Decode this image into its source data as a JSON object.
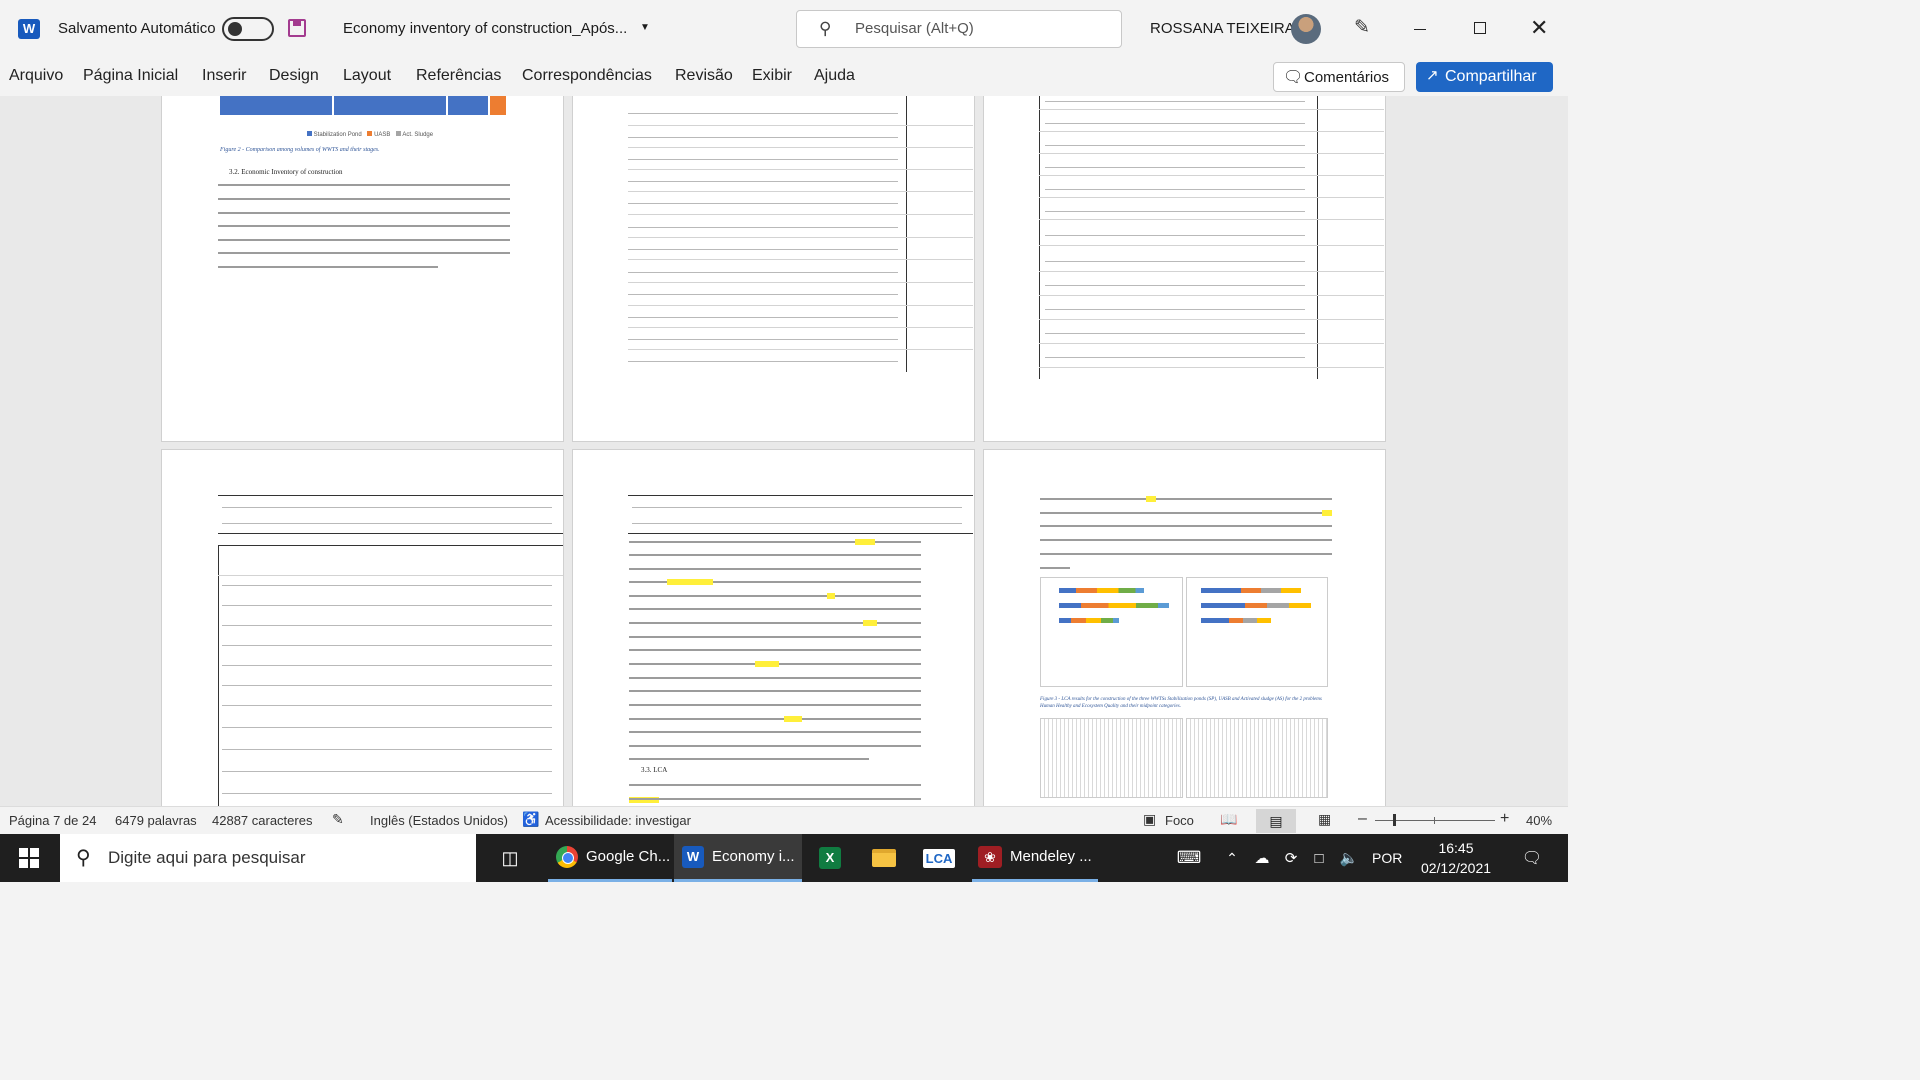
{
  "titlebar": {
    "autosave_label": "Salvamento Automático",
    "doc_title": "Economy inventory of construction_Após...",
    "search_placeholder": "Pesquisar (Alt+Q)",
    "user_name": "ROSSANA TEIXEIRA"
  },
  "ribbon": {
    "tabs": [
      "Arquivo",
      "Página Inicial",
      "Inserir",
      "Design",
      "Layout",
      "Referências",
      "Correspondências",
      "Revisão",
      "Exibir",
      "Ajuda"
    ],
    "comments_label": "Comentários",
    "share_label": "Compartilhar"
  },
  "document": {
    "figure2_caption": "Figure 2 - Comparison among volumes of WWTS and their stages.",
    "figure2_legend": [
      "Stabilization Pond",
      "UASB",
      "Act. Sludge"
    ],
    "section_heading": "3.2. Economic Inventory of construction",
    "section_lca": "3.3. LCA",
    "figure3_caption": "Figure 3 - LCA results for the construction of the three WWTSs Stabilization ponds (SP), UASB and Activated sludge (AS) for the 2 problems Human Healthy and Ecosystem Quality and their midpoint categories."
  },
  "statusbar": {
    "page": "Página 7 de 24",
    "words": "6479 palavras",
    "chars": "42887 caracteres",
    "language": "Inglês (Estados Unidos)",
    "accessibility": "Acessibilidade: investigar",
    "focus": "Foco",
    "zoom": "40%"
  },
  "taskbar": {
    "search_placeholder": "Digite aqui para pesquisar",
    "apps": [
      {
        "label": "Google Ch...",
        "icon": "chrome-icon"
      },
      {
        "label": "Economy i...",
        "icon": "word-icon"
      },
      {
        "label": "",
        "icon": "excel-icon"
      },
      {
        "label": "",
        "icon": "file-explorer-icon"
      },
      {
        "label": "LCA",
        "icon": "lca-icon"
      },
      {
        "label": "Mendeley ...",
        "icon": "mendeley-icon"
      }
    ],
    "language": "POR",
    "time": "16:45",
    "date": "02/12/2021"
  }
}
